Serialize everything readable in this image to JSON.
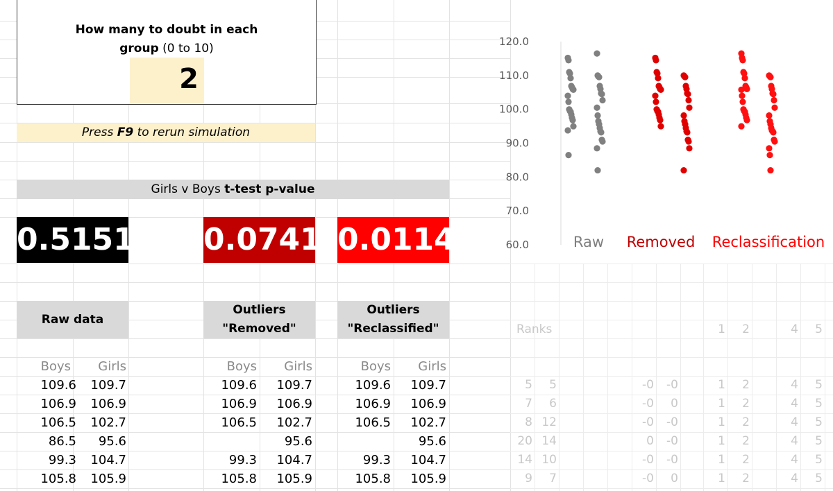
{
  "doubt_box": {
    "title_bold_1": "How many to doubt in each",
    "title_bold_2": "group",
    "title_rest": " (0 to 10)",
    "value": "2"
  },
  "hint": {
    "prefix": "Press ",
    "key": "F9",
    "suffix": " to rerun simulation"
  },
  "ttest": {
    "label_plain": "Girls v Boys ",
    "label_bold": "t-test p-value",
    "values": [
      "0.5151",
      "0.0741",
      "0.0114"
    ],
    "colors": [
      "#000000",
      "#c00000",
      "#ff0000"
    ]
  },
  "sections": {
    "raw": [
      "Raw data"
    ],
    "removed": [
      "Outliers",
      "\"Removed\""
    ],
    "reclassified": [
      "Outliers",
      "\"Reclassified\""
    ]
  },
  "col_headers": {
    "boys": "Boys",
    "girls": "Girls"
  },
  "tables": {
    "raw": [
      [
        "109.6",
        "109.7"
      ],
      [
        "106.9",
        "106.9"
      ],
      [
        "106.5",
        "102.7"
      ],
      [
        "86.5",
        "95.6"
      ],
      [
        "99.3",
        "104.7"
      ],
      [
        "105.8",
        "105.9"
      ]
    ],
    "removed": [
      [
        "109.6",
        "109.7"
      ],
      [
        "106.9",
        "106.9"
      ],
      [
        "106.5",
        "102.7"
      ],
      [
        "",
        "95.6"
      ],
      [
        "99.3",
        "104.7"
      ],
      [
        "105.8",
        "105.9"
      ]
    ],
    "reclassified": [
      [
        "109.6",
        "109.7"
      ],
      [
        "106.9",
        "106.9"
      ],
      [
        "106.5",
        "102.7"
      ],
      [
        "",
        "95.6"
      ],
      [
        "99.3",
        "104.7"
      ],
      [
        "105.8",
        "105.9"
      ]
    ]
  },
  "ranks": {
    "label": "Ranks",
    "header_nums": [
      "1",
      "2",
      "4",
      "5"
    ],
    "rows": [
      [
        "5",
        "5",
        "-0",
        "-0",
        "1",
        "2",
        "4",
        "5"
      ],
      [
        "7",
        "6",
        "-0",
        "0",
        "1",
        "2",
        "4",
        "5"
      ],
      [
        "8",
        "12",
        "-0",
        "-0",
        "1",
        "2",
        "4",
        "5"
      ],
      [
        "20",
        "14",
        "0",
        "-0",
        "1",
        "2",
        "4",
        "5"
      ],
      [
        "14",
        "10",
        "-0",
        "-0",
        "1",
        "2",
        "4",
        "5"
      ],
      [
        "9",
        "7",
        "-0",
        "0",
        "1",
        "2",
        "4",
        "5"
      ]
    ]
  },
  "chart_data": {
    "type": "scatter",
    "y_ticks": [
      "120.0",
      "110.0",
      "100.0",
      "90.0",
      "80.0",
      "70.0",
      "60.0"
    ],
    "ylim": [
      60,
      120
    ],
    "categories": [
      "Raw",
      "Removed",
      "Reclassification"
    ],
    "category_colors": [
      "#808080",
      "#c00000",
      "#ff0000"
    ],
    "point_colors": [
      "#808080",
      "#e00000",
      "#ff1010"
    ],
    "groups": [
      {
        "category": "Raw",
        "boys": [
          115.2,
          114.5,
          111.0,
          110.6,
          109.2,
          106.9,
          106.5,
          106.0,
          105.8,
          104.0,
          102.2,
          100.0,
          99.5,
          99.3,
          98.5,
          97.5,
          96.8,
          95.0,
          93.8,
          86.5
        ],
        "girls": [
          116.5,
          110.0,
          109.7,
          109.5,
          106.9,
          106.0,
          104.7,
          104.5,
          102.7,
          100.5,
          98.2,
          96.5,
          95.6,
          94.5,
          93.5,
          93.2,
          91.0,
          90.5,
          88.5,
          82.0
        ]
      },
      {
        "category": "Removed",
        "boys": [
          115.2,
          114.5,
          111.0,
          110.6,
          109.2,
          106.9,
          106.5,
          106.0,
          105.8,
          104.0,
          102.2,
          100.0,
          99.5,
          99.3,
          98.5,
          97.5,
          96.8,
          95.0
        ],
        "girls": [
          110.0,
          109.7,
          109.5,
          106.9,
          106.0,
          104.7,
          104.5,
          102.7,
          100.5,
          98.2,
          96.5,
          95.6,
          94.5,
          93.5,
          93.2,
          91.0,
          90.5,
          88.5,
          82.0
        ]
      },
      {
        "category": "Reclassification",
        "boys": [
          116.5,
          115.2,
          114.5,
          111.0,
          110.6,
          109.2,
          106.9,
          106.5,
          106.0,
          105.8,
          104.0,
          102.2,
          100.0,
          99.5,
          99.3,
          98.5,
          97.5,
          96.8,
          95.0
        ],
        "girls": [
          110.0,
          109.7,
          109.5,
          106.9,
          106.0,
          104.7,
          104.5,
          102.7,
          100.5,
          98.2,
          96.5,
          95.6,
          94.5,
          93.8,
          93.5,
          93.2,
          91.0,
          90.5,
          88.5,
          86.5,
          82.0
        ]
      }
    ]
  }
}
